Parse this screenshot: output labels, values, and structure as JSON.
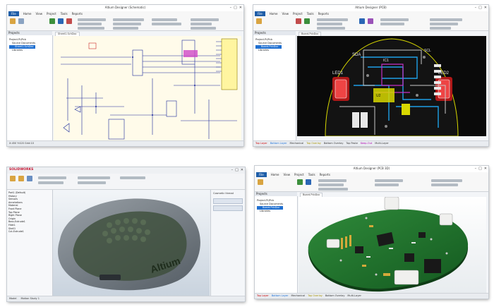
{
  "panels": {
    "schematic": {
      "window_title": "Altium Designer (Schematic)",
      "ribbon_tabs": [
        "File",
        "Home",
        "View",
        "Project",
        "Tools",
        "Reports"
      ],
      "project_header": "Projects",
      "tree": [
        "Project.PrjPcb",
        "Source Documents",
        "Sheet1.SchDoc",
        "Libraries"
      ],
      "doc_tab": "Sheet1.SchDoc",
      "status": "X:450 Y:420  Grid:10"
    },
    "pcb": {
      "window_title": "Altium Designer (PCB)",
      "ribbon_tabs": [
        "File",
        "Home",
        "View",
        "Project",
        "Tools",
        "Reports"
      ],
      "project_header": "Projects",
      "tree": [
        "Project.PrjPcb",
        "Source Documents",
        "Board.PcbDoc",
        "Libraries"
      ],
      "doc_tab": "Board.PcbDoc",
      "board_labels": [
        "LED1",
        "LED2",
        "IC1",
        "U2",
        "SDA",
        "SCL"
      ],
      "layer_tabs": [
        "Top Layer",
        "Bottom Layer",
        "Mechanical",
        "Top Overlay",
        "Bottom Overlay",
        "Top Paste",
        "Keep-Out",
        "Multi-Layer"
      ],
      "status": "Layers"
    },
    "solidworks": {
      "brand": "SOLIDWORKS",
      "feature_items": [
        "Part1 (Default)",
        "History",
        "Sensors",
        "Annotations",
        "Material",
        "Front Plane",
        "Top Plane",
        "Right Plane",
        "Origin",
        "Boss-Extrude1",
        "Fillet1",
        "Shell1",
        "Cut-Extrude1"
      ],
      "side_header": "Cosmetic thread",
      "logo_text": "Altium",
      "bottom_tabs": [
        "Model",
        "Motion Study 1"
      ]
    },
    "pcb3d": {
      "window_title": "Altium Designer (PCB 3D)",
      "ribbon_tabs": [
        "File",
        "Home",
        "View",
        "Project",
        "Tools",
        "Reports"
      ],
      "project_header": "Projects",
      "tree": [
        "Project.PrjPcb",
        "Source Documents",
        "Board.PcbDoc",
        "Libraries"
      ],
      "doc_tab": "Board.PcbDoc",
      "layer_tabs": [
        "Top Layer",
        "Bottom Layer",
        "Mechanical",
        "Top Overlay",
        "Bottom Overlay",
        "Multi-Layer"
      ]
    }
  },
  "colors": {
    "file_tab": "#1f5ea8",
    "schematic_bg": "#fffbea",
    "pcb_bg": "#0a0a0a",
    "pcb_green": "#1f6e2c",
    "solidworks_bg": "#dfe6ee"
  }
}
